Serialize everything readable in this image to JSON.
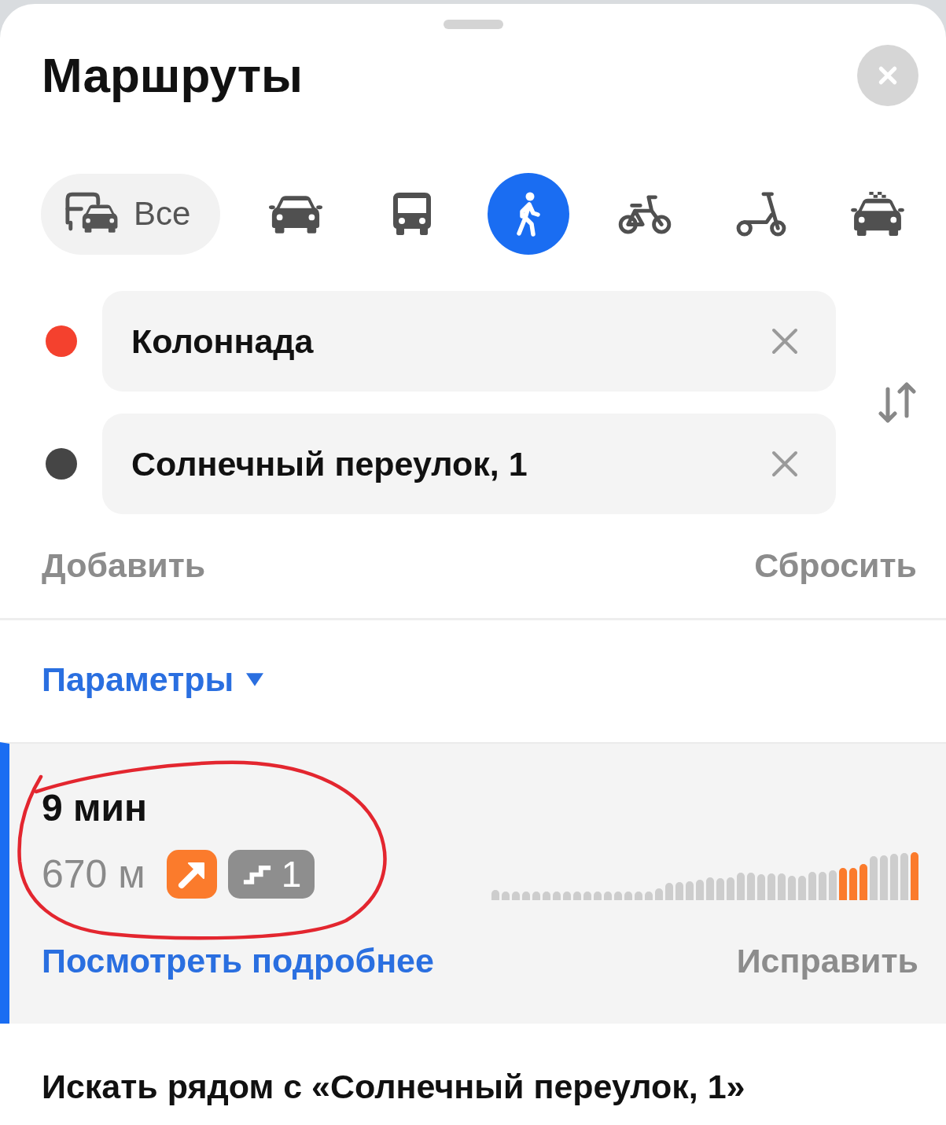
{
  "sheet": {
    "title": "Маршруты"
  },
  "modes": [
    {
      "kind": "all",
      "label": "Все",
      "selected": false
    },
    {
      "kind": "car",
      "selected": false
    },
    {
      "kind": "bus",
      "selected": false
    },
    {
      "kind": "walk",
      "selected": true
    },
    {
      "kind": "bike",
      "selected": false
    },
    {
      "kind": "scooter",
      "selected": false
    },
    {
      "kind": "taxi",
      "selected": false
    }
  ],
  "waypoints": [
    {
      "value": "Колоннада",
      "color": "#f4412e"
    },
    {
      "value": "Солнечный переулок, 1",
      "color": "#454545"
    }
  ],
  "actions": {
    "add": "Добавить",
    "reset": "Сбросить"
  },
  "parameters": {
    "label": "Параметры",
    "expanded": false
  },
  "route": {
    "selected": true,
    "circled": true,
    "duration": "9 мин",
    "distance": "670 м",
    "badges": [
      {
        "kind": "ascent"
      },
      {
        "kind": "stairs",
        "count": "1"
      }
    ],
    "details_link": "Посмотреть подробнее",
    "fix": "Исправить"
  },
  "nearby": "Искать рядом с «Солнечный переулок, 1»"
}
